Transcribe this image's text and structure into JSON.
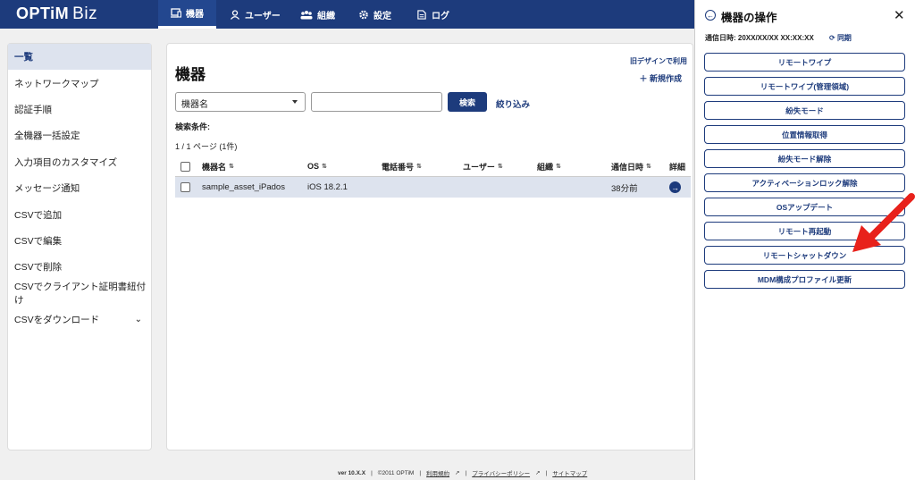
{
  "header": {
    "brand": "OPTiM",
    "brand_sub": "Biz",
    "nav": [
      {
        "label": "機器",
        "icon": "device-icon",
        "active": true
      },
      {
        "label": "ユーザー",
        "icon": "user-icon"
      },
      {
        "label": "組織",
        "icon": "org-icon"
      },
      {
        "label": "設定",
        "icon": "gear-icon"
      },
      {
        "label": "ログ",
        "icon": "log-icon"
      }
    ]
  },
  "sidebar": {
    "items": [
      {
        "label": "一覧"
      },
      {
        "label": "ネットワークマップ"
      },
      {
        "label": "認証手順"
      },
      {
        "label": "全機器一括設定"
      },
      {
        "label": "入力項目のカスタマイズ"
      },
      {
        "label": "メッセージ通知"
      },
      {
        "label": "CSVで追加"
      },
      {
        "label": "CSVで編集"
      },
      {
        "label": "CSVで削除"
      },
      {
        "label": "CSVでクライアント証明書紐付け"
      },
      {
        "label": "CSVをダウンロード"
      }
    ]
  },
  "main": {
    "title": "機器",
    "old_design": "旧デザインで利用",
    "new_create": "新規作成",
    "search": {
      "select_value": "機器名",
      "input_value": "",
      "button": "検索",
      "filter": "絞り込み"
    },
    "conditions_label": "検索条件:",
    "page_count": "1 / 1 ページ (1件)",
    "table": {
      "columns": [
        "機器名",
        "OS",
        "電話番号",
        "ユーザー",
        "組織",
        "通信日時",
        "詳細"
      ],
      "rows": [
        {
          "name": "sample_asset_iPados",
          "os": "iOS 18.2.1",
          "phone": "",
          "user": "",
          "org": "",
          "time": "38分前"
        }
      ]
    }
  },
  "footer": {
    "version": "ver 10.X.X",
    "copyright": "©2011 OPTiM",
    "links": [
      "利用規約",
      "プライバシーポリシー",
      "サイトマップ"
    ]
  },
  "drawer": {
    "title": "機器の操作",
    "comm_time": "通信日時: 20XX/XX/XX XX:XX:XX",
    "sync": "同期",
    "buttons": [
      "リモートワイプ",
      "リモートワイプ(管理領域)",
      "紛失モード",
      "位置情報取得",
      "紛失モード解除",
      "アクティベーションロック解除",
      "OSアップデート",
      "リモート再起動",
      "リモートシャットダウン",
      "MDM構成プロファイル更新"
    ]
  },
  "colors": {
    "brand": "#1d3b7c",
    "selected_row": "#dde3ee",
    "annotation_arrow": "#e8211b"
  }
}
